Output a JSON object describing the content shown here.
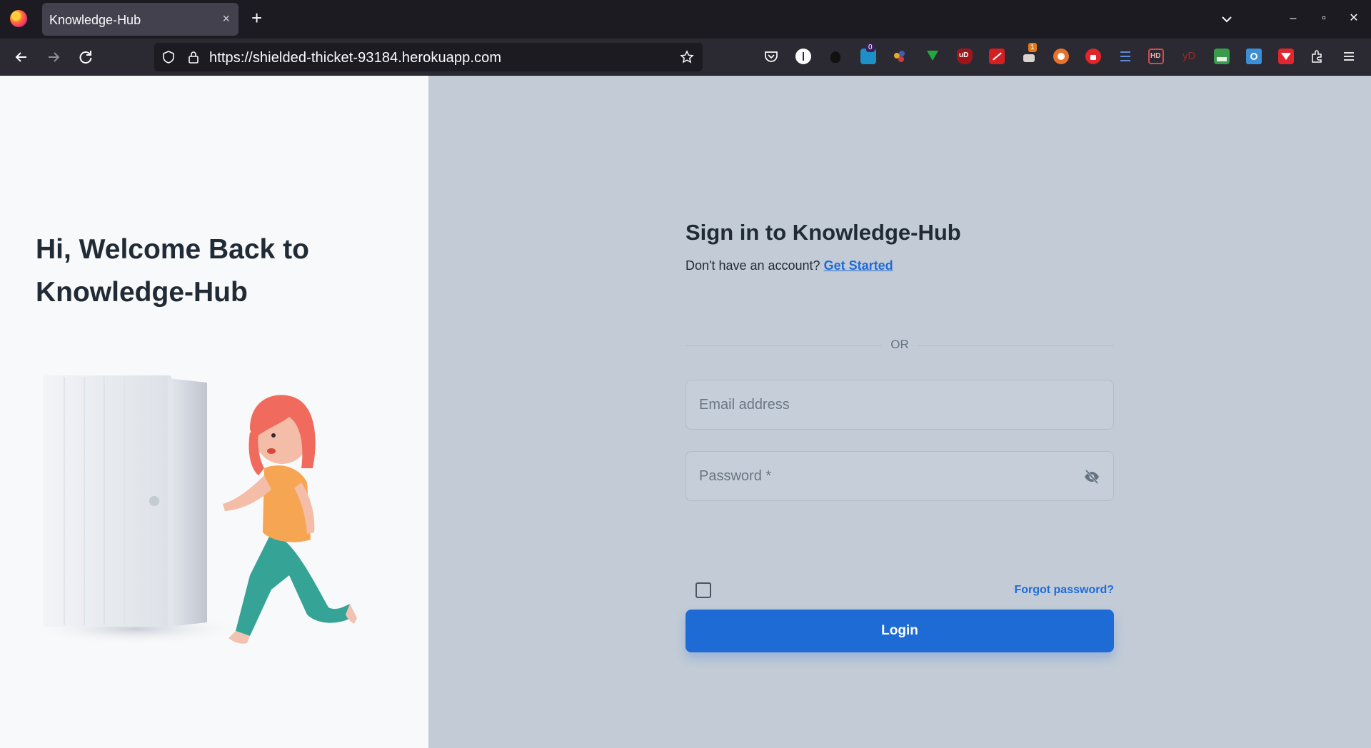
{
  "browser": {
    "tab_title": "Knowledge-Hub",
    "tab_close_glyph": "×",
    "new_tab_glyph": "+",
    "url": "https://shielded-thicket-93184.herokuapp.com",
    "extension_badges": {
      "badge_a": "0",
      "badge_b": "1"
    },
    "window_controls": {
      "minimize": "–",
      "maximize": "▫",
      "close": "✕"
    }
  },
  "welcome": {
    "heading_line1": "Hi, Welcome Back to",
    "heading_line2": "Knowledge-Hub"
  },
  "signin": {
    "title": "Sign in to Knowledge-Hub",
    "no_account_text": "Don't have an account?",
    "get_started_link": "Get Started",
    "divider_text": "OR",
    "email_placeholder": "Email address",
    "password_placeholder": "Password *",
    "forgot_password_link": "Forgot password?",
    "login_button": "Login",
    "remember_checked": false
  },
  "colors": {
    "primary": "#1f6bd6",
    "right_bg": "#c3ccd6",
    "left_bg": "#f8f9fa",
    "text_dark": "#212b36"
  }
}
